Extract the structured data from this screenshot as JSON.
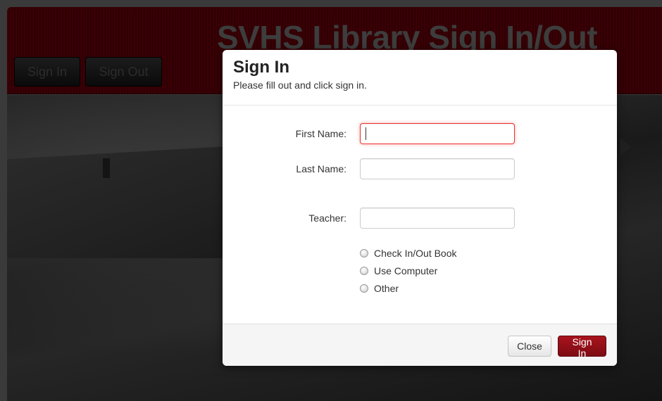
{
  "page": {
    "title": "SVHS Library Sign In/Out"
  },
  "nav": {
    "sign_in_label": "Sign In",
    "sign_out_label": "Sign Out"
  },
  "modal": {
    "title": "Sign In",
    "subtitle": "Please fill out and click sign in.",
    "fields": {
      "first_name_label": "First Name:",
      "first_name_value": "",
      "last_name_label": "Last Name:",
      "last_name_value": "",
      "teacher_label": "Teacher:",
      "teacher_value": ""
    },
    "options": [
      {
        "label": "Check In/Out Book",
        "selected": false
      },
      {
        "label": "Use Computer",
        "selected": false
      },
      {
        "label": "Other",
        "selected": false
      }
    ],
    "close_label": "Close",
    "submit_label": "Sign In"
  },
  "colors": {
    "header_band": "#3a0005",
    "primary_button": "#8e0f17",
    "focus_border": "#e9322d"
  }
}
